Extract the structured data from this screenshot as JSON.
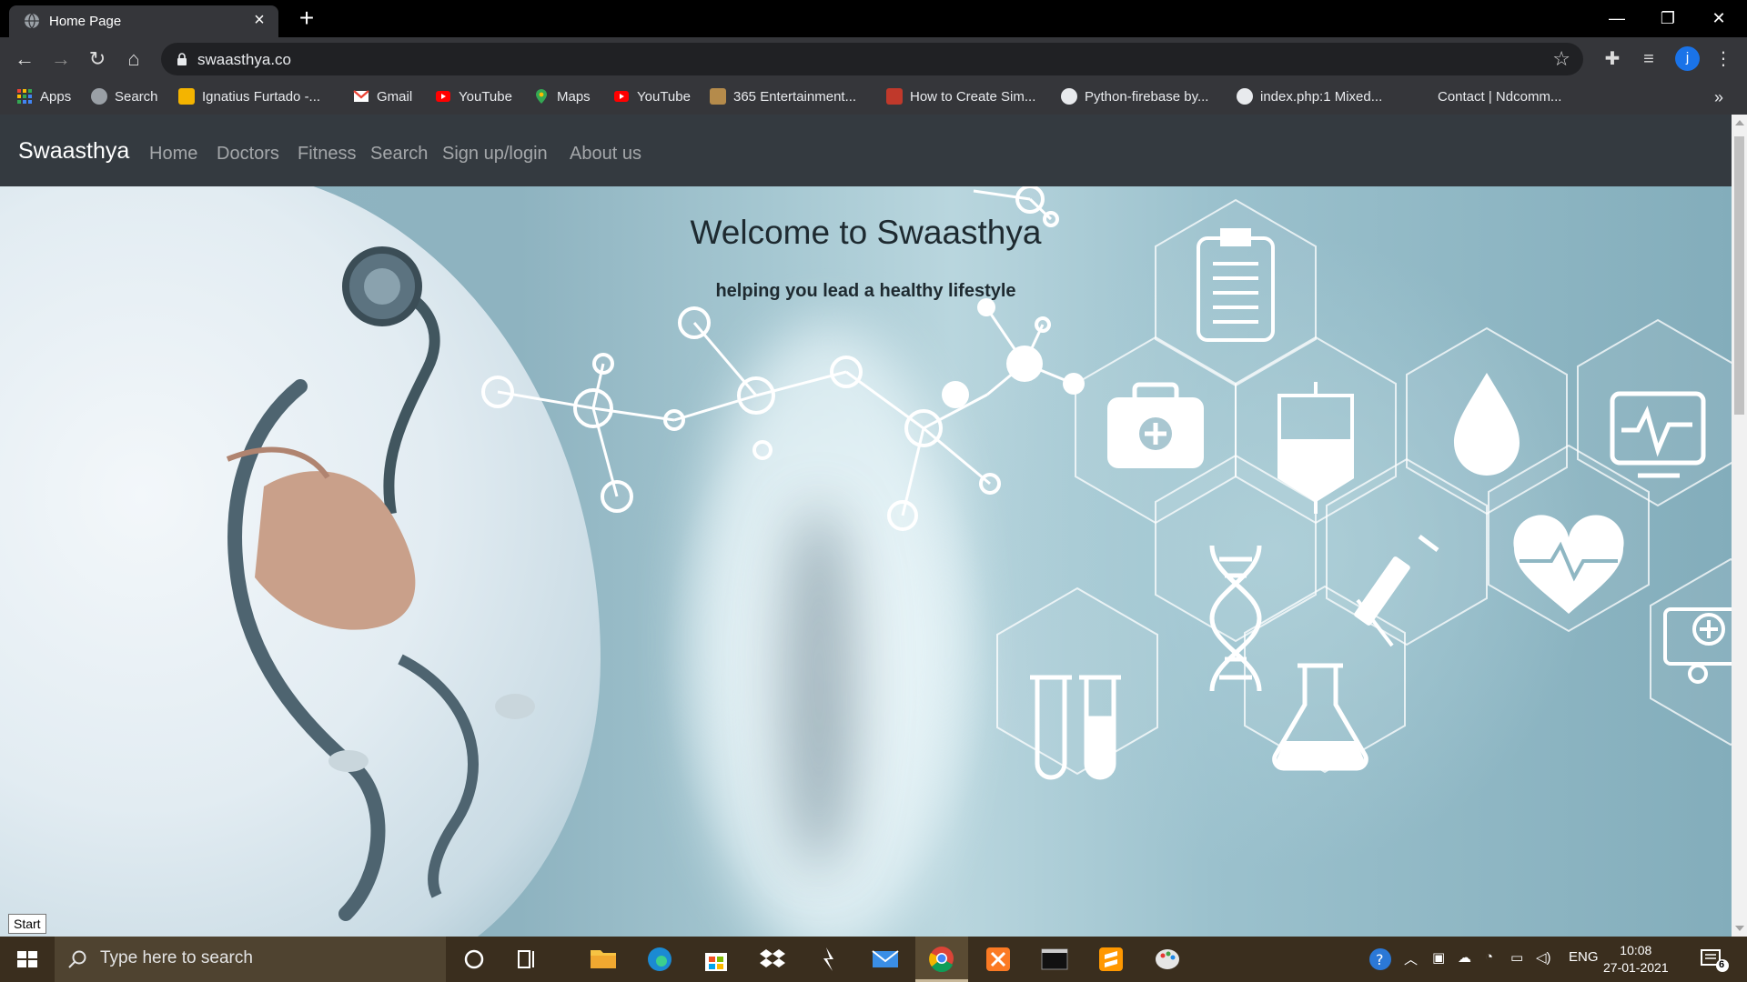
{
  "browser": {
    "tab_title": "Home Page",
    "url": "swaasthya.co",
    "profile_initial": "j",
    "bookmarks": [
      {
        "label": "Apps",
        "icon": "apps-grid-icon"
      },
      {
        "label": "Search",
        "icon": "search-bookmark-icon"
      },
      {
        "label": "Ignatius Furtado -...",
        "icon": "bookmark-yellow-icon"
      },
      {
        "label": "Gmail",
        "icon": "gmail-icon"
      },
      {
        "label": "YouTube",
        "icon": "youtube-icon"
      },
      {
        "label": "Maps",
        "icon": "maps-icon"
      },
      {
        "label": "YouTube",
        "icon": "youtube-icon"
      },
      {
        "label": "365 Entertainment...",
        "icon": "365-icon"
      },
      {
        "label": "How to Create Sim...",
        "icon": "bookmark-red-icon"
      },
      {
        "label": "Python-firebase by...",
        "icon": "globe-icon"
      },
      {
        "label": "index.php:1 Mixed...",
        "icon": "globe-icon"
      },
      {
        "label": "Contact | Ndcomm...",
        "icon": "blank-icon"
      }
    ]
  },
  "site": {
    "brand": "Swaasthya",
    "nav": [
      "Home",
      "Doctors",
      "Fitness",
      "Search",
      "Sign up/login",
      "About us"
    ],
    "hero_title": "Welcome to Swaasthya",
    "hero_subtitle": "helping you lead a healthy lifestyle"
  },
  "tooltip": "Start",
  "taskbar": {
    "search_placeholder": "Type here to search",
    "language": "ENG",
    "time": "10:08",
    "date": "27-01-2021",
    "notification_count": "6"
  },
  "colors": {
    "navbar": "#343a40",
    "chrome_toolbar": "#35363a",
    "taskbar": "#3a2e1e"
  }
}
